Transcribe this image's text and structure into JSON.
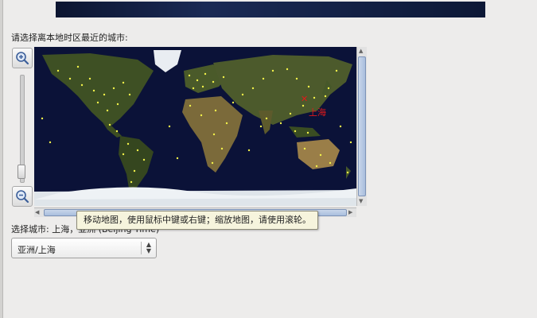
{
  "prompt": "请选择离本地时区最近的城市:",
  "map": {
    "selected_city_label": "上海",
    "marker_symbol": "✕",
    "ocean_color": "#0b1238",
    "land_color": "#3a4a22",
    "dot_color": "#f2f24a",
    "marker_color": "#e01a1a"
  },
  "zoom": {
    "in_icon": "zoom-in-icon",
    "out_icon": "zoom-out-icon"
  },
  "tooltip": "移动地图，使用鼠标中键或右键；缩放地图，请使用滚轮。",
  "selected_city_text": "选择城市: 上海，亚洲 (Beijing Time)",
  "timezone_select": {
    "value": "亚洲/上海"
  }
}
